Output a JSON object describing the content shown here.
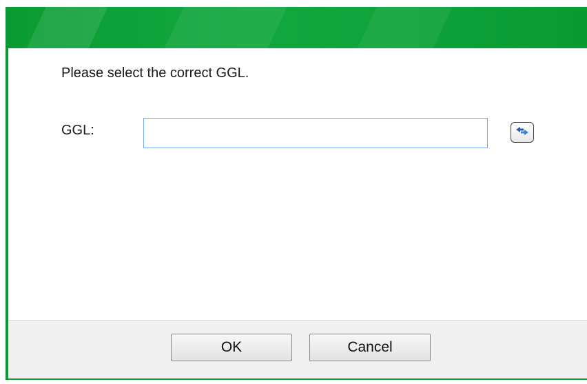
{
  "dialog": {
    "prompt": "Please select the correct GGL.",
    "ggl_label": "GGL:",
    "ggl_value": "",
    "ggl_placeholder": ""
  },
  "icons": {
    "refresh": "refresh-icon"
  },
  "buttons": {
    "ok_label": "OK",
    "cancel_label": "Cancel"
  },
  "colors": {
    "title_bar": "#0a9a32",
    "input_border": "#7aa9e8",
    "footer_bg": "#f0f0f0"
  }
}
